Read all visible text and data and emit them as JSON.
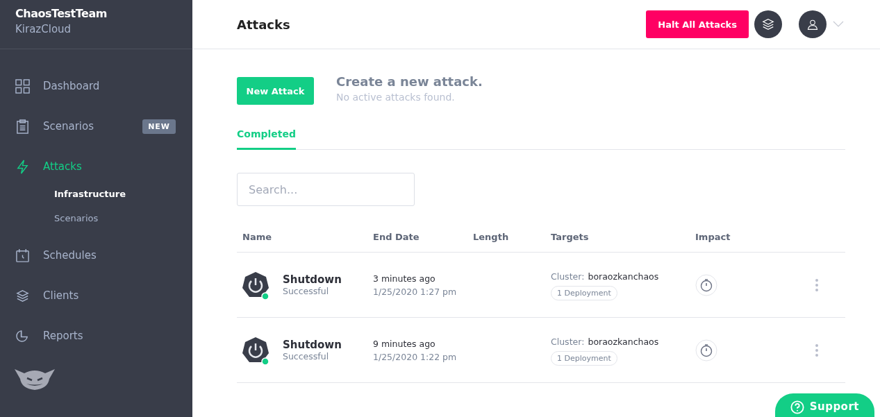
{
  "team": {
    "name": "ChaosTestTeam",
    "org": "KirazCloud"
  },
  "nav": [
    {
      "label": "Dashboard",
      "selected": false
    },
    {
      "label": "Scenarios",
      "selected": false,
      "badge": "NEW"
    },
    {
      "label": "Attacks",
      "selected": true,
      "children": [
        {
          "label": "Infrastructure",
          "selected": true
        },
        {
          "label": "Scenarios",
          "selected": false
        }
      ]
    },
    {
      "label": "Schedules",
      "selected": false
    },
    {
      "label": "Clients",
      "selected": false
    },
    {
      "label": "Reports",
      "selected": false
    }
  ],
  "header": {
    "title": "Attacks",
    "halt_button": "Halt All Attacks"
  },
  "new_attack": {
    "button": "New Attack",
    "title": "Create a new attack.",
    "subtitle": "No active attacks found."
  },
  "tabs": [
    {
      "label": "Completed",
      "selected": true
    }
  ],
  "search": {
    "placeholder": "Search..."
  },
  "table": {
    "columns": [
      "Name",
      "End Date",
      "Length",
      "Targets",
      "Impact"
    ],
    "rows": [
      {
        "name": "Shutdown",
        "status": "Successful",
        "relative": "3 minutes ago",
        "date": "1/25/2020 1:27 pm",
        "cluster_label": "Cluster:",
        "cluster": "boraozkanchaos",
        "tag": "1 Deployment"
      },
      {
        "name": "Shutdown",
        "status": "Successful",
        "relative": "9 minutes ago",
        "date": "1/25/2020 1:22 pm",
        "cluster_label": "Cluster:",
        "cluster": "boraozkanchaos",
        "tag": "1 Deployment"
      }
    ]
  },
  "support": {
    "label": "Support"
  }
}
